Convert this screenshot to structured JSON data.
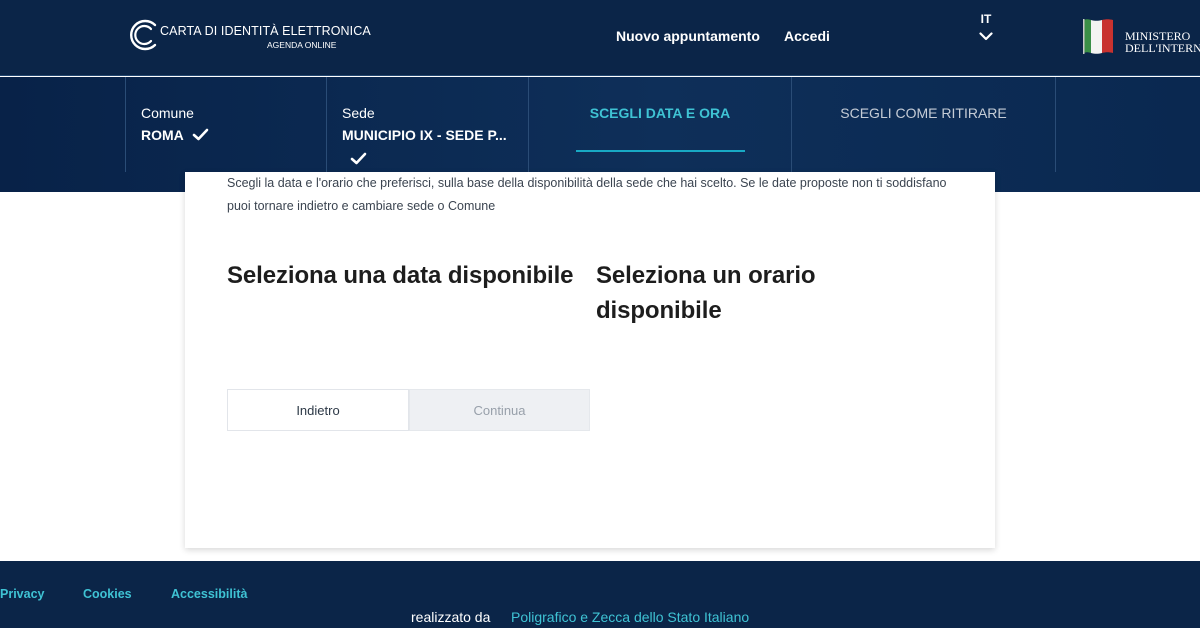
{
  "header": {
    "logo_title": "CARTA DI IDENTITÀ ELETTRONICA",
    "logo_subtitle": "AGENDA ONLINE",
    "nav": {
      "new_appointment": "Nuovo appuntamento",
      "login": "Accedi"
    },
    "language": "IT",
    "ministry_line1": "MINISTERO",
    "ministry_line2": "DELL'INTERNO"
  },
  "steps": [
    {
      "label": "Comune",
      "value": "ROMA",
      "state": "done"
    },
    {
      "label": "Sede",
      "value": "MUNICIPIO IX - SEDE P...",
      "state": "done"
    },
    {
      "title": "SCEGLI DATA E ORA",
      "state": "active"
    },
    {
      "title": "SCEGLI COME RITIRARE",
      "state": "pending"
    }
  ],
  "main": {
    "intro": "Scegli la data e l'orario che preferisci, sulla base della disponibilità della sede che hai scelto. Se le date proposte non ti soddisfano puoi tornare indietro e cambiare sede o Comune",
    "date_title": "Seleziona una data disponibile",
    "time_title": "Seleziona un orario disponibile",
    "back_button": "Indietro",
    "continue_button": "Continua"
  },
  "footer": {
    "links": [
      "Privacy",
      "Cookies",
      "Accessibilità"
    ],
    "made_by": "realizzato da",
    "maker": "Poligrafico e Zecca dello Stato Italiano"
  },
  "colors": {
    "header_bg": "#0b2548",
    "accent": "#18a9c4",
    "footer_link": "#3fc3d4",
    "active_step_text": "#3fc3d4",
    "pending_step_text": "#c5ccd6",
    "flag_green": "#3a8f46",
    "flag_red": "#c8322f"
  },
  "icons": [
    "cie-logo-icon",
    "chevron-down-icon",
    "italian-flag-icon",
    "check-icon"
  ]
}
